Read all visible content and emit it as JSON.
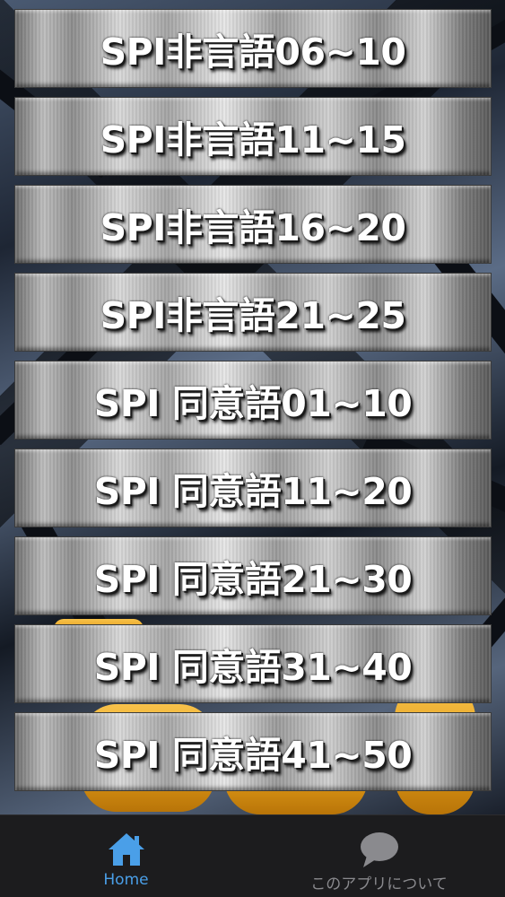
{
  "menu": {
    "items": [
      {
        "label": "SPI非言語06~10"
      },
      {
        "label": "SPI非言語11~15"
      },
      {
        "label": "SPI非言語16~20"
      },
      {
        "label": "SPI非言語21~25"
      },
      {
        "label": "SPI 同意語01~10"
      },
      {
        "label": "SPI 同意語11~20"
      },
      {
        "label": "SPI 同意語21~30"
      },
      {
        "label": "SPI 同意語31~40"
      },
      {
        "label": "SPI 同意語41~50"
      }
    ]
  },
  "tabbar": {
    "home": {
      "label": "Home",
      "icon": "home-icon",
      "active": true,
      "color": "#4a9fe8"
    },
    "about": {
      "label": "このアプリについて",
      "icon": "speech-bubble-icon",
      "active": false,
      "color": "#8a8a8e"
    }
  },
  "colors": {
    "tabbar_background": "#1c1c1e",
    "active_tab": "#4a9fe8",
    "inactive_tab": "#8a8a8e",
    "button_text": "#ffffff"
  }
}
